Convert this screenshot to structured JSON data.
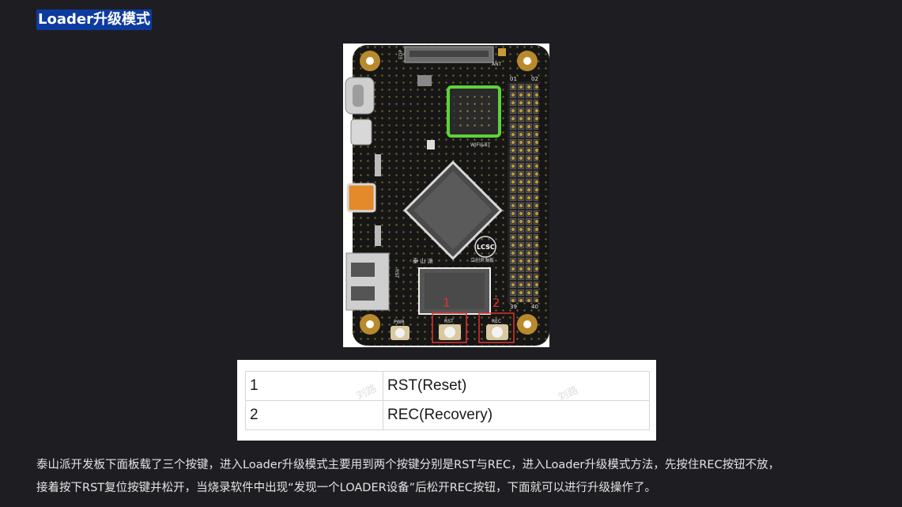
{
  "heading": "Loader升级模式",
  "board": {
    "silk_edp": "EDP",
    "silk_ant": "ANT",
    "silk_wifi": "WIFI&BT",
    "pin_01": "01",
    "pin_02": "02",
    "pin_39": "39",
    "pin_40": "40",
    "logo_lceda": "LCSC",
    "logo_name": "泰 山 派",
    "logo_sub": "立创开发板",
    "btn_pwr": "PWR",
    "btn_rst": "RST",
    "btn_rec": "REC",
    "marker_1": "1",
    "marker_2": "2",
    "silk_rst_side": "RST"
  },
  "key_table": {
    "rows": [
      {
        "num": "1",
        "desc": "RST(Reset)"
      },
      {
        "num": "2",
        "desc": "REC(Recovery)"
      }
    ]
  },
  "watermark": "刘路",
  "paragraph": {
    "line1": "泰山派开发板下面板载了三个按键，进入Loader升级模式主要用到两个按键分别是RST与REC，进入Loader升级模式方法，先按住REC按钮不放，",
    "line2": "接着按下RST复位按键并松开，当烧录软件中出现“发现一个LOADER设备”后松开REC按钮，下面就可以进行升级操作了。"
  }
}
